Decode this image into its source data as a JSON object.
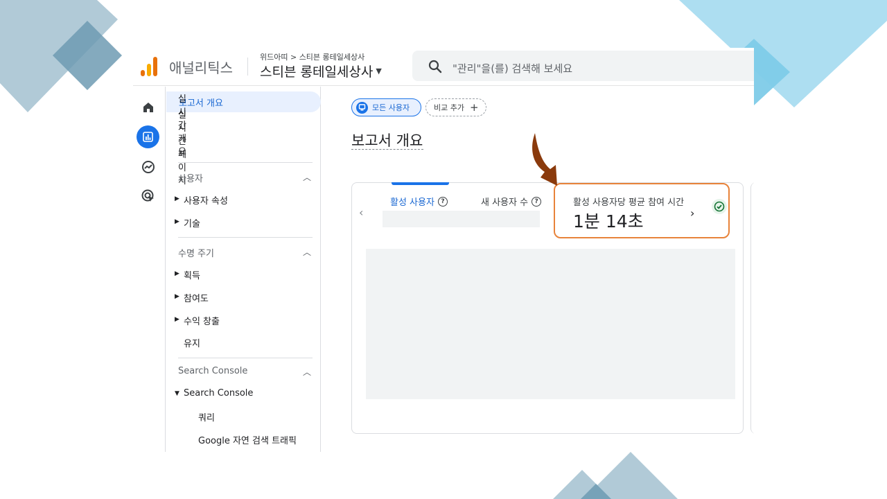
{
  "header": {
    "app_name": "애널리틱스",
    "breadcrumb": "위드아띠 > 스티븐 롱테일세상사",
    "property_name": "스티븐 롱테일세상사",
    "search_placeholder": "\"관리\"을(를) 검색해 보세요"
  },
  "rail": {
    "icons": [
      "home-icon",
      "reports-icon",
      "explore-icon",
      "advertising-icon"
    ],
    "active": "reports-icon"
  },
  "nav": {
    "top_items": [
      "보고서 개요",
      "실시간 개요",
      "실시간 페이지"
    ],
    "selected": "보고서 개요",
    "sections": [
      {
        "title": "사용자",
        "items": [
          "사용자 속성",
          "기술"
        ]
      },
      {
        "title": "수명 주기",
        "items": [
          "획득",
          "참여도",
          "수익 창출",
          "유지"
        ]
      },
      {
        "title": "Search Console",
        "items": [
          "Search Console"
        ],
        "subitems": [
          "쿼리",
          "Google 자연 검색 트래픽"
        ]
      }
    ]
  },
  "main": {
    "chip_user": "모든 사용자",
    "chip_add": "비교 추가",
    "page_title": "보고서 개요",
    "card": {
      "metric1_label": "활성 사용자",
      "metric2_label": "새 사용자 수",
      "metric3_label": "활성 사용자당 평균 참여 시간",
      "metric3_value": "1분 14초"
    }
  },
  "colors": {
    "accent": "#1a73e8",
    "highlight": "#e8833a",
    "arrow": "#8a3a0c",
    "deco_blue": "#7ecbe8",
    "deco_slate": "#6f9bb3"
  }
}
